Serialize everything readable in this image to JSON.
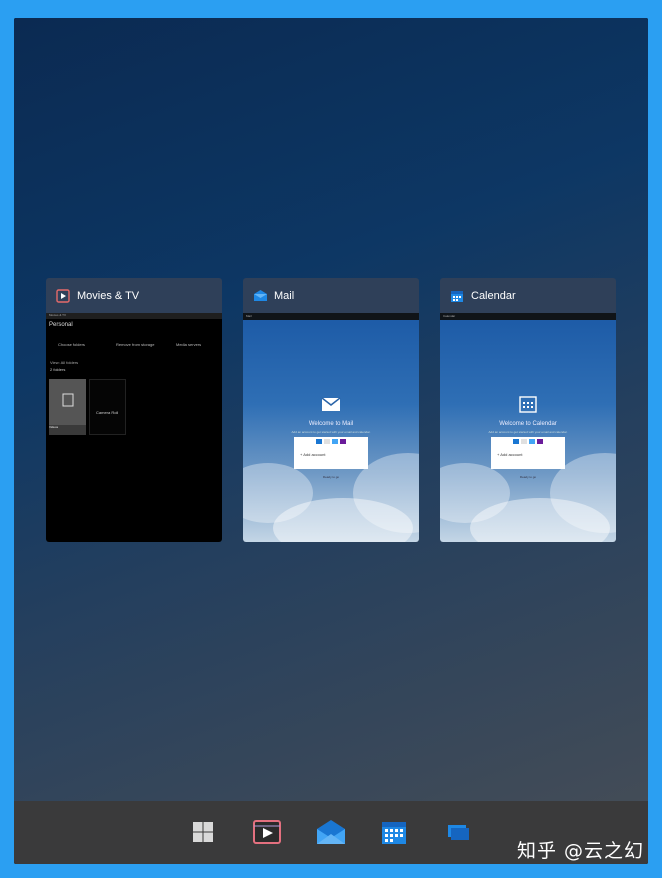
{
  "task_view": {
    "windows": [
      {
        "app": "Movies & TV",
        "icon": "movies-tv-icon",
        "thumbnail": {
          "app_label": "Movies & TV",
          "section": "Personal",
          "toolbar": [
            "Choose folders",
            "Remove from storage",
            "Media servers"
          ],
          "filter": "View: All folders",
          "count": "2 folders",
          "tiles": [
            "Videos",
            "Camera Roll"
          ]
        }
      },
      {
        "app": "Mail",
        "icon": "mail-icon",
        "thumbnail": {
          "app_label": "Mail",
          "welcome": "Welcome to Mail",
          "subtitle": "Add an account to get started with your email and calendar.",
          "add_account": "+ Add account",
          "link": "Ready to go"
        }
      },
      {
        "app": "Calendar",
        "icon": "calendar-icon",
        "thumbnail": {
          "app_label": "Calendar",
          "welcome": "Welcome to Calendar",
          "subtitle": "Add an account to get started with your email and calendar.",
          "add_account": "+ Add account",
          "link": "Ready to go"
        }
      }
    ]
  },
  "taskbar": {
    "items": [
      {
        "name": "Start",
        "icon": "windows-logo-icon"
      },
      {
        "name": "Movies & TV",
        "icon": "movies-tv-icon"
      },
      {
        "name": "Mail",
        "icon": "mail-icon"
      },
      {
        "name": "Calendar",
        "icon": "calendar-icon"
      },
      {
        "name": "Task View",
        "icon": "task-view-icon"
      }
    ]
  },
  "watermark": "知乎 @云之幻",
  "colors": {
    "frame": "#2b9ff2",
    "taskbar": "#3a3a3b",
    "card": "#2f4059",
    "accent_blue": "#0078d7"
  }
}
